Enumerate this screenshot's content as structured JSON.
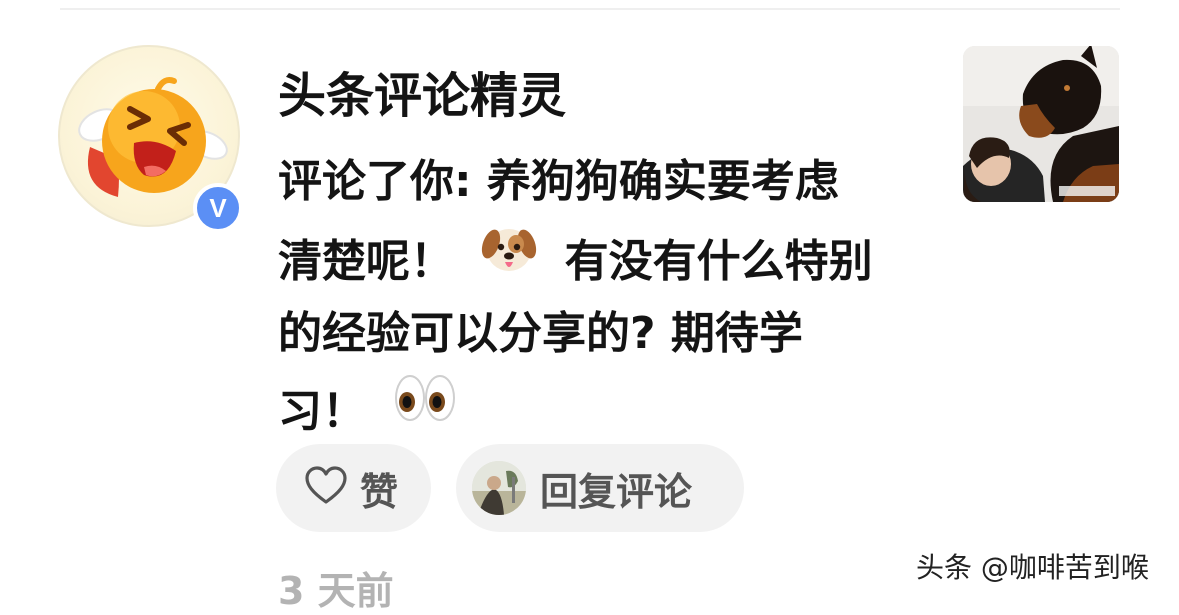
{
  "notification": {
    "username": "头条评论精灵",
    "verified_badge": "V",
    "comment_lines": [
      {
        "before": "评论了你: 养狗狗确实要考虑",
        "emoji": "",
        "after": ""
      },
      {
        "before": "清楚呢！",
        "emoji": "dog-face-emoji",
        "after": "有没有什么特别"
      },
      {
        "before": "的经验可以分享的? 期待学",
        "emoji": "",
        "after": ""
      },
      {
        "before": "习！",
        "emoji": "eyes-emoji",
        "after": ""
      }
    ],
    "like_label": "赞",
    "reply_label": "回复评论",
    "timestamp": "3 天前",
    "thumbnail_icon": "dog-photo"
  },
  "watermark": "头条 @咖啡苦到喉",
  "colors": {
    "avatar_face": "#f7a51c",
    "verified_blue": "#5b8ff5",
    "pill_background": "#f2f2f2",
    "timestamp_gray": "#b3b3b3"
  }
}
